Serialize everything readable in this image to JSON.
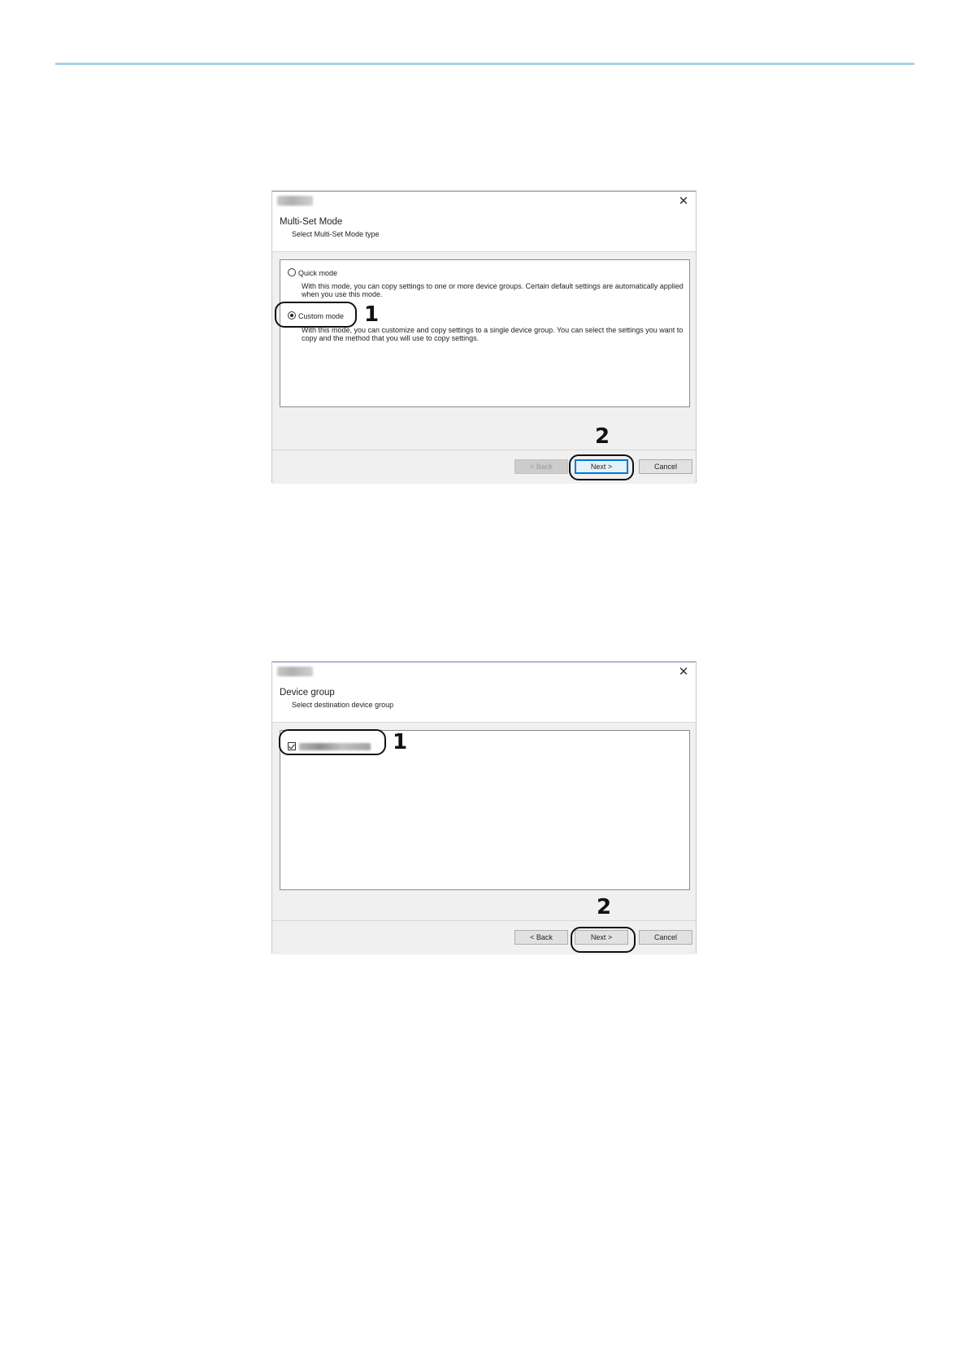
{
  "dialog1": {
    "header_title": "Multi-Set Mode",
    "header_subtitle": "Select Multi-Set Mode type",
    "options": [
      {
        "label": "Quick mode",
        "selected": false,
        "description": "With this mode, you can copy settings to one or more device groups. Certain default settings are automatically applied when you use this mode."
      },
      {
        "label": "Custom mode",
        "selected": true,
        "description": "With this mode, you can customize and copy settings to a single device group. You can select the settings you want to copy and the method that you will use to copy settings."
      }
    ],
    "buttons": {
      "back": "< Back",
      "next": "Next >",
      "cancel": "Cancel"
    },
    "callouts": [
      "1",
      "2"
    ]
  },
  "dialog2": {
    "header_title": "Device group",
    "header_subtitle": "Select destination device group",
    "group_item": {
      "checked": true
    },
    "buttons": {
      "back": "< Back",
      "next": "Next >",
      "cancel": "Cancel"
    },
    "callouts": [
      "1",
      "2"
    ]
  },
  "icons": {
    "close": "close-icon",
    "radio": "radio-icon",
    "checkbox": "checkbox-icon"
  },
  "colors": {
    "rule": "#a9d3ea",
    "default_button_border": "#0078d7"
  }
}
